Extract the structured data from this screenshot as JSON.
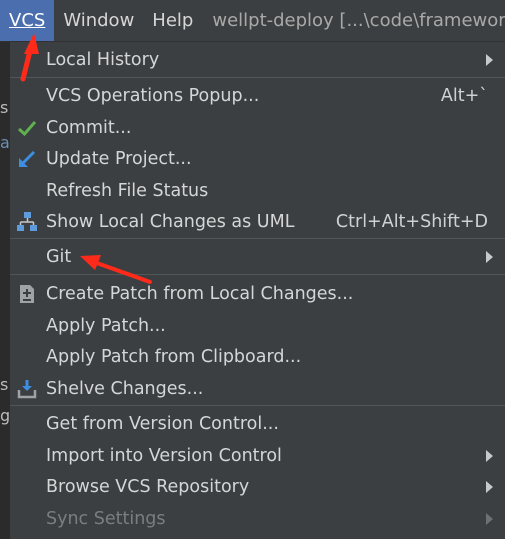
{
  "menubar": {
    "items": [
      {
        "label": "VCS",
        "active": true
      },
      {
        "label": "Window"
      },
      {
        "label": "Help"
      }
    ],
    "title": "wellpt-deploy [...\\code\\framework"
  },
  "background": {
    "left_fragments": [
      "si",
      "ac",
      "s",
      "g"
    ]
  },
  "menu": {
    "items": [
      {
        "label": "Local History",
        "submenu": true
      },
      {
        "label": "VCS Operations Popup...",
        "shortcut": "Alt+`"
      },
      {
        "label": "Commit...",
        "icon": "checkmark-icon"
      },
      {
        "label": "Update Project...",
        "icon": "update-arrow-icon"
      },
      {
        "label": "Refresh File Status"
      },
      {
        "label": "Show Local Changes as UML",
        "shortcut": "Ctrl+Alt+Shift+D",
        "icon": "uml-diagram-icon"
      },
      {
        "label": "Git",
        "submenu": true
      },
      {
        "label": "Create Patch from Local Changes...",
        "icon": "patch-icon"
      },
      {
        "label": "Apply Patch..."
      },
      {
        "label": "Apply Patch from Clipboard..."
      },
      {
        "label": "Shelve Changes...",
        "icon": "shelve-icon"
      },
      {
        "label": "Get from Version Control..."
      },
      {
        "label": "Import into Version Control",
        "submenu": true
      },
      {
        "label": "Browse VCS Repository",
        "submenu": true
      },
      {
        "label": "Sync Settings",
        "submenu": true,
        "disabled": true
      }
    ]
  },
  "colors": {
    "menu_bg": "#3c3f41",
    "active_menu": "#4b6eaf",
    "annotation_red": "#ff2a1a",
    "commit_green": "#5fb14f",
    "update_blue": "#3d8ee0"
  }
}
